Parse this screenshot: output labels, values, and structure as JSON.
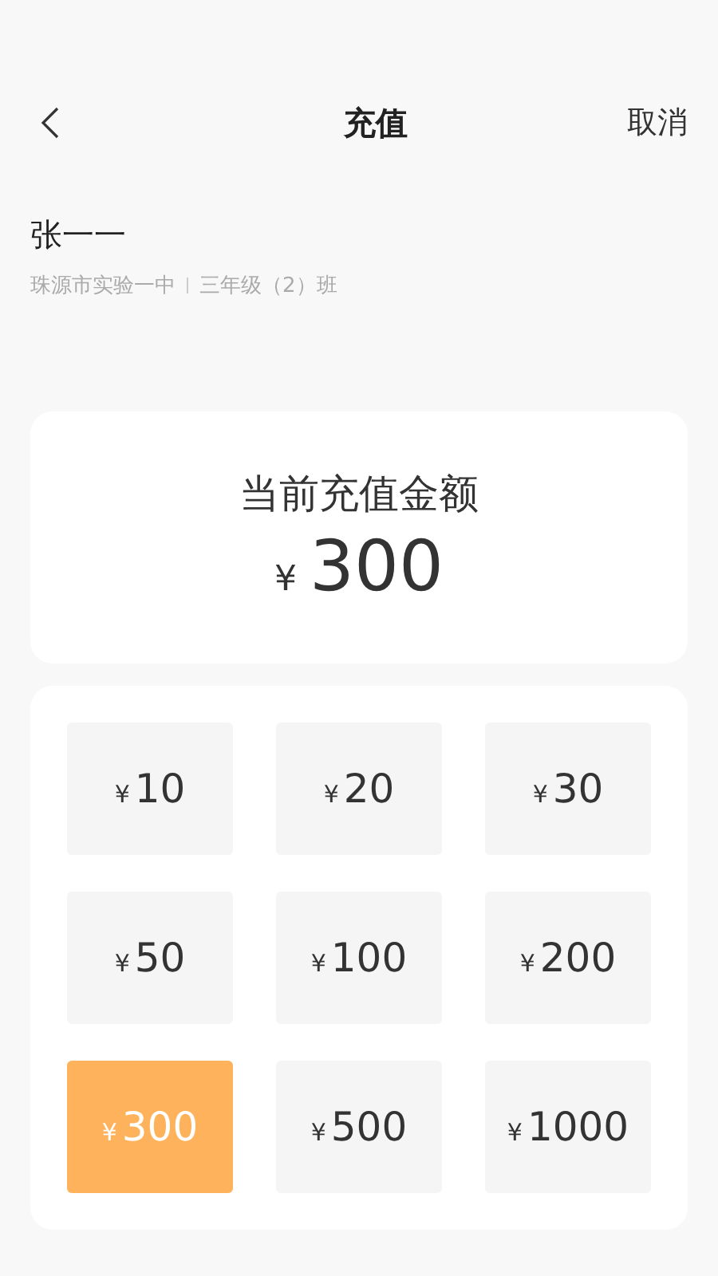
{
  "header": {
    "title": "充值",
    "action": "取消"
  },
  "student": {
    "name": "张一一",
    "school": "珠源市实验一中",
    "class": "三年级（2）班"
  },
  "current": {
    "label": "当前充值金额",
    "currency": "¥",
    "amount": "300"
  },
  "options": [
    {
      "currency": "¥",
      "amount": "10",
      "selected": false
    },
    {
      "currency": "¥",
      "amount": "20",
      "selected": false
    },
    {
      "currency": "¥",
      "amount": "30",
      "selected": false
    },
    {
      "currency": "¥",
      "amount": "50",
      "selected": false
    },
    {
      "currency": "¥",
      "amount": "100",
      "selected": false
    },
    {
      "currency": "¥",
      "amount": "200",
      "selected": false
    },
    {
      "currency": "¥",
      "amount": "300",
      "selected": true
    },
    {
      "currency": "¥",
      "amount": "500",
      "selected": false
    },
    {
      "currency": "¥",
      "amount": "1000",
      "selected": false
    }
  ]
}
